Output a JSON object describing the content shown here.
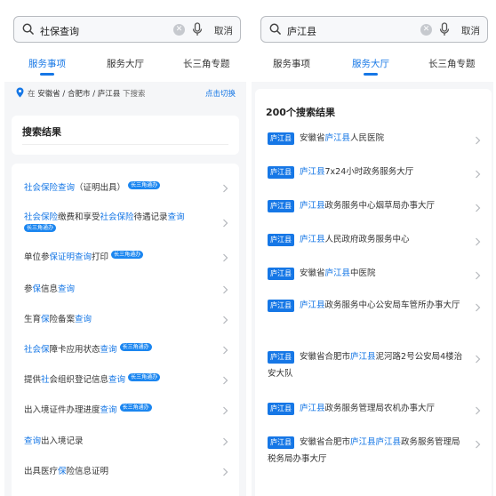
{
  "left": {
    "search": {
      "query": "社保查询",
      "cancel": "取消"
    },
    "tabs": [
      {
        "label": "服务事项",
        "active": true
      },
      {
        "label": "服务大厅",
        "active": false
      },
      {
        "label": "长三角专题",
        "active": false
      }
    ],
    "location": {
      "prefix": "在",
      "place": "安徽省 / 合肥市 / 庐江县",
      "suffix": "下搜索",
      "switch": "点击切换"
    },
    "results_title": "搜索结果",
    "badge_text": "长三角通办",
    "items": [
      {
        "segments": [
          [
            "社会保险查询",
            true
          ],
          [
            "（证明出具）",
            false
          ]
        ],
        "badge": true
      },
      {
        "segments": [
          [
            "社会保险",
            true
          ],
          [
            "缴费和享受",
            false
          ],
          [
            "社会保险",
            true
          ],
          [
            "待遇记录",
            false
          ],
          [
            "查询",
            true
          ]
        ],
        "badge": true
      },
      {
        "segments": [
          [
            "单位参",
            false
          ],
          [
            "保证明查询",
            true
          ],
          [
            "打印",
            false
          ]
        ],
        "badge": true
      },
      {
        "segments": [
          [
            "参",
            false
          ],
          [
            "保",
            true
          ],
          [
            "信息",
            false
          ],
          [
            "查询",
            true
          ]
        ],
        "badge": false
      },
      {
        "segments": [
          [
            "生育",
            false
          ],
          [
            "保",
            true
          ],
          [
            "险备案",
            false
          ],
          [
            "查询",
            true
          ]
        ],
        "badge": false
      },
      {
        "segments": [
          [
            "社会保",
            true
          ],
          [
            "障卡应用状态",
            false
          ],
          [
            "查询",
            true
          ]
        ],
        "badge": true
      },
      {
        "segments": [
          [
            "提供",
            false
          ],
          [
            "社",
            true
          ],
          [
            "会组织登记信息",
            false
          ],
          [
            "查询",
            true
          ]
        ],
        "badge": true
      },
      {
        "segments": [
          [
            "出入境证件办理进度",
            false
          ],
          [
            "查询",
            true
          ]
        ],
        "badge": true
      },
      {
        "segments": [
          [
            "查询",
            true
          ],
          [
            "出入境记录",
            false
          ]
        ],
        "badge": false
      },
      {
        "segments": [
          [
            "出具医疗",
            false
          ],
          [
            "保",
            true
          ],
          [
            "险信息证明",
            false
          ]
        ],
        "badge": false
      }
    ]
  },
  "right": {
    "search": {
      "query": "庐江县",
      "cancel": "取消"
    },
    "tabs": [
      {
        "label": "服务事项",
        "active": false
      },
      {
        "label": "服务大厅",
        "active": true
      },
      {
        "label": "长三角专题",
        "active": false
      }
    ],
    "results_title": "200个搜索结果",
    "tag_text": "庐江县",
    "items": [
      {
        "segments": [
          [
            "安徽省",
            false
          ],
          [
            "庐江县",
            true
          ],
          [
            "人民医院",
            false
          ]
        ]
      },
      {
        "segments": [
          [
            "庐江县",
            true
          ],
          [
            "7x24小时政务服务大厅",
            false
          ]
        ]
      },
      {
        "segments": [
          [
            "庐江县",
            true
          ],
          [
            "政务服务中心烟草局办事大厅",
            false
          ]
        ]
      },
      {
        "segments": [
          [
            "庐江县",
            true
          ],
          [
            "人民政府政务服务中心",
            false
          ]
        ]
      },
      {
        "segments": [
          [
            "安徽省",
            false
          ],
          [
            "庐江县",
            true
          ],
          [
            "中医院",
            false
          ]
        ]
      },
      {
        "segments": [
          [
            "庐江县",
            true
          ],
          [
            "政务服务中心公安局车管所办事大厅",
            false
          ]
        ]
      },
      {
        "segments": [
          [
            "安徽省合肥市",
            false
          ],
          [
            "庐江县",
            true
          ],
          [
            "泥河路2号公安局4楼治安大队",
            false
          ]
        ]
      },
      {
        "segments": [
          [
            "庐江县",
            true
          ],
          [
            "政务服务管理局农机办事大厅",
            false
          ]
        ]
      },
      {
        "segments": [
          [
            "安徽省合肥市",
            false
          ],
          [
            "庐江县庐江县",
            true
          ],
          [
            "政务服务管理局税务局办事大厅",
            false
          ]
        ]
      }
    ]
  },
  "colors": {
    "accent": "#1677e6",
    "badge": "#1b86f0",
    "background": "#f5f6f8"
  },
  "icons": [
    "search-icon",
    "clear-icon",
    "microphone-icon",
    "location-pin-icon",
    "chevron-right-icon"
  ]
}
